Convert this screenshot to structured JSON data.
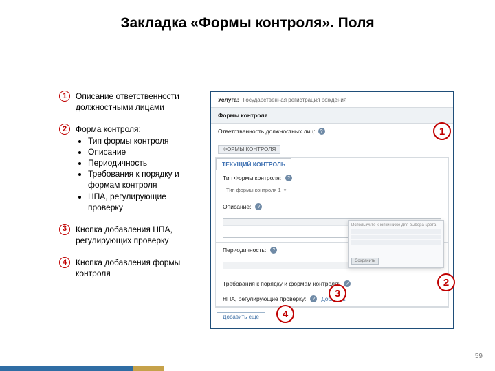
{
  "slide": {
    "title": "Закладка «Формы контроля». Поля",
    "page_number": "59"
  },
  "legend": {
    "item1": {
      "num": "1",
      "text": "Описание ответственности должностными лицами"
    },
    "item2": {
      "num": "2",
      "heading": "Форма контроля:",
      "bullets": [
        "Тип формы контроля",
        "Описание",
        "Периодичность",
        "Требования к порядку и формам контроля",
        "НПА, регулирующие проверку"
      ]
    },
    "item3": {
      "num": "3",
      "text": "Кнопка добавления НПА, регулирующих проверку"
    },
    "item4": {
      "num": "4",
      "text": "Кнопка добавления формы контроля"
    }
  },
  "screenshot": {
    "service_label": "Услуга:",
    "service_value": "Государственная регистрация рождения",
    "section_header": "Формы контроля",
    "resp_label": "Ответственность должностных лиц:",
    "help_glyph": "?",
    "forms_section_label": "ФОРМЫ КОНТРОЛЯ",
    "tab_label": "ТЕКУЩИЙ КОНТРОЛЬ",
    "field_type_label": "Тип Формы контроля:",
    "field_type_value": "Тип формы контроля 1",
    "field_desc_label": "Описание:",
    "field_period_label": "Периодичность:",
    "field_req_label": "Требования к порядку и формам контроля:",
    "field_npa_label": "НПА, регулирующие проверку:",
    "add_npa_link": "Добавить",
    "add_more_btn": "Добавить еще",
    "panel_hint": "Используйте кнопки ниже для выбора цвета",
    "panel_btn": "Сохранить"
  },
  "overlay": {
    "b1": "1",
    "b2": "2",
    "b3": "3",
    "b4": "4"
  }
}
